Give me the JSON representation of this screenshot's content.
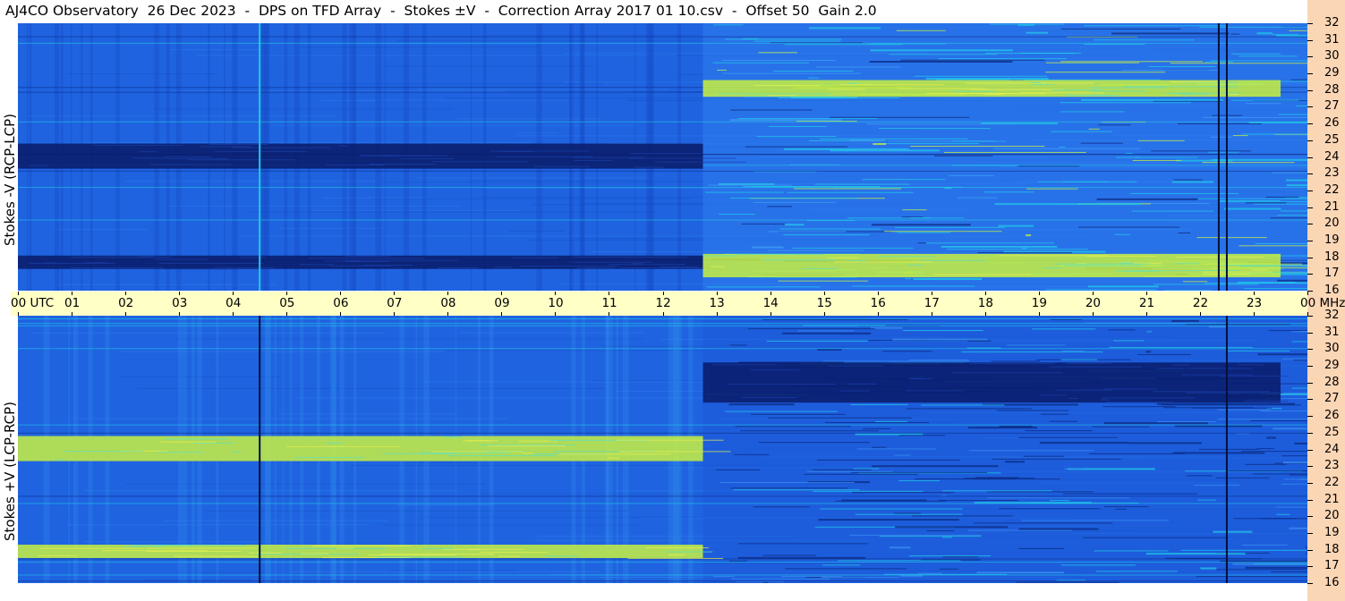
{
  "title": "AJ4CO Observatory  26 Dec 2023  -  DPS on TFD Array  -  Stokes ±V  -  Correction Array 2017 01 10.csv  -  Offset 50  Gain 2.0",
  "panels": [
    {
      "id": "top",
      "ylabel": "Stokes -V (RCP-LCP)"
    },
    {
      "id": "bottom",
      "ylabel": "Stokes +V (LCP-RCP)"
    }
  ],
  "time_axis": {
    "labels": [
      "00 UTC",
      "01",
      "02",
      "03",
      "04",
      "05",
      "06",
      "07",
      "08",
      "09",
      "10",
      "11",
      "12",
      "13",
      "14",
      "15",
      "16",
      "17",
      "18",
      "19",
      "20",
      "21",
      "22",
      "23",
      "00 MHz"
    ]
  },
  "freq_axis": {
    "labels": [
      "32",
      "31",
      "30",
      "29",
      "28",
      "27",
      "26",
      "25",
      "24",
      "23",
      "22",
      "21",
      "20",
      "19",
      "18",
      "17",
      "16"
    ]
  },
  "colors": {
    "background_blue": "#1f63e0",
    "dark_blue": "#0a1e6e",
    "cyan": "#22c8e8",
    "yellow_green": "#c8f040",
    "time_bar": "#ffffc6",
    "right_bar": "#fbd6b5"
  },
  "chart_data": {
    "type": "heatmap",
    "x_unit": "UTC hour",
    "y_unit": "MHz",
    "xlim": [
      0,
      24
    ],
    "ylim": [
      16,
      32
    ],
    "panels": [
      {
        "name": "Stokes -V (RCP-LCP)",
        "features": [
          {
            "kind": "dark_band",
            "t": [
              0,
              12.75
            ],
            "f": [
              23.3,
              24.8
            ]
          },
          {
            "kind": "dark_band",
            "t": [
              0,
              12.75
            ],
            "f": [
              17.3,
              18.1
            ]
          },
          {
            "kind": "bright_band",
            "t": [
              12.75,
              23.5
            ],
            "f": [
              27.6,
              28.6
            ]
          },
          {
            "kind": "bright_band",
            "t": [
              12.75,
              23.5
            ],
            "f": [
              16.8,
              18.2
            ]
          },
          {
            "kind": "vertical_line",
            "t": 4.5,
            "shade": "cyan"
          },
          {
            "kind": "vertical_line",
            "t": 22.35,
            "shade": "dark"
          },
          {
            "kind": "vertical_line",
            "t": 22.5,
            "shade": "dark"
          }
        ]
      },
      {
        "name": "Stokes +V (LCP-RCP)",
        "features": [
          {
            "kind": "bright_band",
            "t": [
              0,
              12.75
            ],
            "f": [
              23.3,
              24.8
            ]
          },
          {
            "kind": "bright_band",
            "t": [
              0,
              12.75
            ],
            "f": [
              17.5,
              18.3
            ]
          },
          {
            "kind": "dark_band",
            "t": [
              12.75,
              23.5
            ],
            "f": [
              26.8,
              29.2
            ]
          },
          {
            "kind": "vertical_line",
            "t": 4.5,
            "shade": "dark"
          },
          {
            "kind": "vertical_line",
            "t": 22.5,
            "shade": "dark"
          }
        ]
      }
    ]
  }
}
